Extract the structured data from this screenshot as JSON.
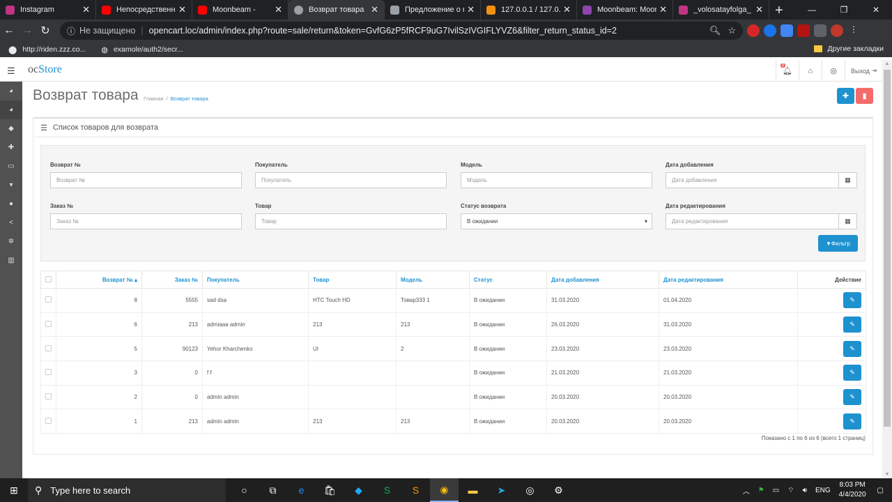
{
  "browser": {
    "tabs": [
      {
        "title": "Instagram",
        "color": "#c13584"
      },
      {
        "title": "Непосредственно",
        "color": "#ff0000"
      },
      {
        "title": "Moonbeam -",
        "color": "#ff0000"
      },
      {
        "title": "Возврат товара",
        "color": "#9aa0a6",
        "active": true
      },
      {
        "title": "Предложение о п",
        "color": "#9aa0a6"
      },
      {
        "title": "127.0.0.1 / 127.0.0",
        "color": "#f29111"
      },
      {
        "title": "Moonbeam: Moon",
        "color": "#8e44ad"
      },
      {
        "title": "_volosatayfolga_",
        "color": "#c13584"
      }
    ],
    "insecure_label": "Не защищено",
    "url": "opencart.loc/admin/index.php?route=sale/return&token=GvfG6zP5fRCF9uG7IvilSzIVGIFLYVZ6&filter_return_status_id=2",
    "bookmarks": [
      "http://riden.zzz.co...",
      "examole/auth2/secr..."
    ],
    "bookmarks_folder": "Другие закладки"
  },
  "header": {
    "logo_oc": "oc",
    "logo_store": "Store",
    "notify_count": "1",
    "logout_label": "Выход"
  },
  "page": {
    "title": "Возврат товара",
    "breadcrumb_home": "Главная",
    "breadcrumb_sep": "/",
    "breadcrumb_current": "Возврат товара"
  },
  "panel": {
    "title": "Список товаров для возврата"
  },
  "filter": {
    "return_id_label": "Возврат №",
    "return_id_placeholder": "Возврат №",
    "customer_label": "Покупатель",
    "customer_placeholder": "Покупатель",
    "model_label": "Модель",
    "model_placeholder": "Модель",
    "date_added_label": "Дата добавления",
    "date_added_placeholder": "Дата добавления",
    "order_id_label": "Заказ №",
    "order_id_placeholder": "Заказ №",
    "product_label": "Товар",
    "product_placeholder": "Товар",
    "status_label": "Статус возврата",
    "status_value": "В ожидании",
    "date_modified_label": "Дата редактирования",
    "date_modified_placeholder": "Дата редактирования",
    "button_label": "Фильтр"
  },
  "table": {
    "headers": {
      "return_id": "Возврат №",
      "order_id": "Заказ №",
      "customer": "Покупатель",
      "product": "Товар",
      "model": "Модель",
      "status": "Статус",
      "date_added": "Дата добавления",
      "date_modified": "Дата редактирования",
      "action": "Действие"
    },
    "rows": [
      {
        "return_id": "8",
        "order_id": "5555",
        "customer": "sad dsa",
        "product": "HTC Touch HD",
        "model": "Товар333 1",
        "status": "В ожидании",
        "date_added": "31.03.2020",
        "date_modified": "01.04.2020"
      },
      {
        "return_id": "6",
        "order_id": "213",
        "customer": "admiaaa admin",
        "product": "213",
        "model": "213",
        "status": "В ожидании",
        "date_added": "26.03.2020",
        "date_modified": "31.03.2020"
      },
      {
        "return_id": "5",
        "order_id": "90123",
        "customer": "Yehor Kharchenko",
        "product": "UI",
        "model": "2",
        "status": "В ожидании",
        "date_added": "23.03.2020",
        "date_modified": "23.03.2020"
      },
      {
        "return_id": "3",
        "order_id": "0",
        "customer": "f f",
        "product": "",
        "model": "",
        "status": "В ожидании",
        "date_added": "21.03.2020",
        "date_modified": "21.03.2020"
      },
      {
        "return_id": "2",
        "order_id": "0",
        "customer": "admin admin",
        "product": "",
        "model": "",
        "status": "В ожидании",
        "date_added": "20.03.2020",
        "date_modified": "20.03.2020"
      },
      {
        "return_id": "1",
        "order_id": "213",
        "customer": "admin admin",
        "product": "213",
        "model": "213",
        "status": "В ожидании",
        "date_added": "20.03.2020",
        "date_modified": "20.03.2020"
      }
    ],
    "pagination_text": "Показано с 1 по 6 из 6 (всего 1 страниц)"
  },
  "taskbar": {
    "search_placeholder": "Type here to search",
    "lang": "ENG",
    "time": "8:03 PM",
    "date": "4/4/2020"
  }
}
